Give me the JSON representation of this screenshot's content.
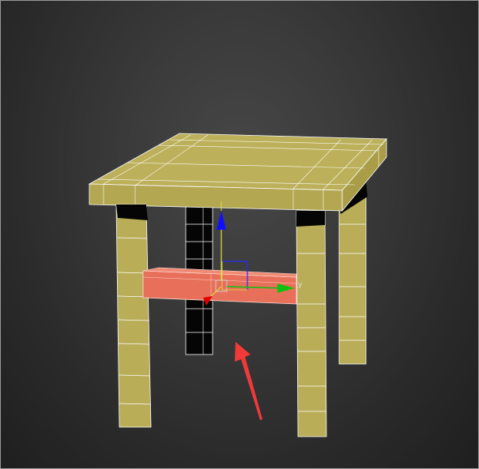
{
  "viewport": {
    "title": "",
    "gizmo": {
      "y_axis_label": "y",
      "z_axis_color": "#1010ff",
      "y_axis_color": "#10c010",
      "x_axis_color": "#e00000",
      "plane_color": "#2a2aff"
    },
    "colors": {
      "table_wood": "#b9ad58",
      "table_wood_dark": "#a89c48",
      "selected_crossbar": "#e8705a",
      "hidden_leg": "#050505",
      "annotation_arrow": "#f03a3a"
    }
  }
}
